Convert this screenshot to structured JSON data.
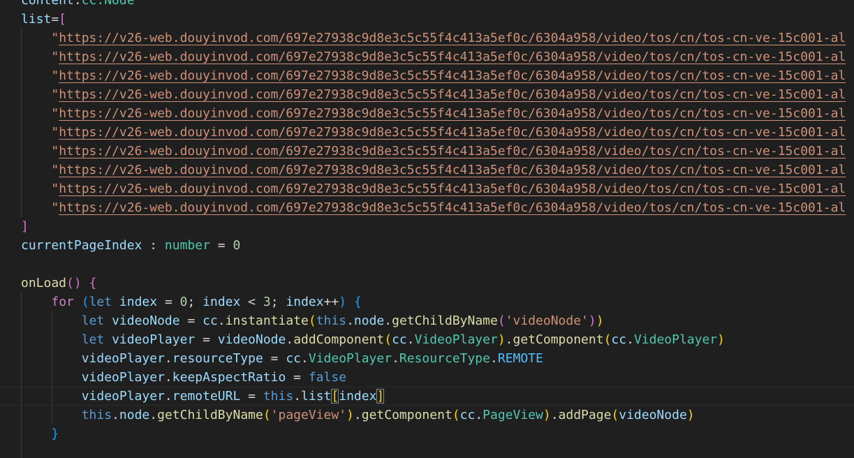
{
  "editor": {
    "content_prop": "content",
    "content_type": "cc.Node",
    "list_name": "list",
    "url_prefix": "https://v26-web.douyinvod.com/697e27938c9d8e3c5c55f4c413a5ef0c/6304a958/video/tos/cn/tos-cn-ve-15c001-al",
    "url_count": 10,
    "current_page_prop": "currentPageIndex",
    "current_page_type": "number",
    "current_page_value": "0",
    "onload_fn": "onLoad",
    "loop": {
      "keyword": "for",
      "let": "let",
      "var": "index",
      "start": "0",
      "limit": "3"
    },
    "video_node_var": "videoNode",
    "video_player_var": "videoPlayer",
    "cc": "cc",
    "instantiate_fn": "instantiate",
    "this_kw": "this",
    "node_prop": "node",
    "get_child_fn": "getChildByName",
    "video_node_str": "'videoNode'",
    "add_component_fn": "addComponent",
    "get_component_fn": "getComponent",
    "video_player_type": "VideoPlayer",
    "resource_type_prop": "resourceType",
    "resource_type_enum": "ResourceType",
    "remote_const": "REMOTE",
    "keep_aspect_prop": "keepAspectRatio",
    "false_kw": "false",
    "remote_url_prop": "remoteURL",
    "list_prop": "list",
    "page_view_str": "'pageView'",
    "page_view_type": "PageView",
    "add_page_fn": "addPage"
  },
  "colors": {
    "background": "#1f1f1f",
    "property": "#9cdcfe",
    "type": "#4ec9b0",
    "string": "#ce9178",
    "keyword": "#569cd6",
    "control": "#c586c0",
    "number": "#b5cea8",
    "function": "#dcdcaa",
    "enum_member": "#4fc1ff"
  }
}
